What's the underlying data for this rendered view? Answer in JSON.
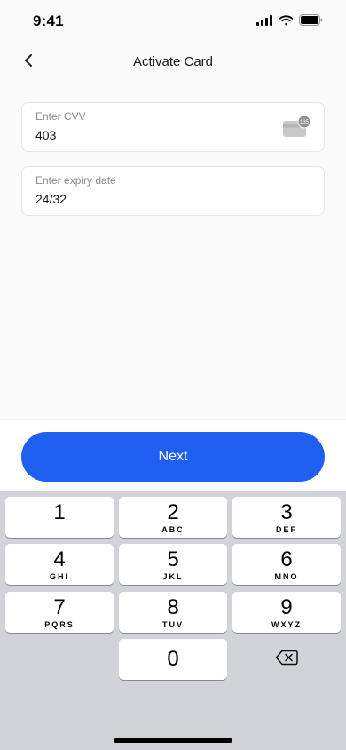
{
  "status_bar": {
    "time": "9:41"
  },
  "nav": {
    "title": "Activate Card"
  },
  "form": {
    "cvv": {
      "label": "Enter CVV",
      "value": "403",
      "card_badge": "135"
    },
    "expiry": {
      "label": "Enter expiry date",
      "value": "24/32"
    }
  },
  "actions": {
    "next_label": "Next",
    "accent_color": "#1f5ff2"
  },
  "keypad": {
    "keys": [
      {
        "digit": "1",
        "letters": ""
      },
      {
        "digit": "2",
        "letters": "ABC"
      },
      {
        "digit": "3",
        "letters": "DEF"
      },
      {
        "digit": "4",
        "letters": "GHI"
      },
      {
        "digit": "5",
        "letters": "JKL"
      },
      {
        "digit": "6",
        "letters": "MNO"
      },
      {
        "digit": "7",
        "letters": "PQRS"
      },
      {
        "digit": "8",
        "letters": "TUV"
      },
      {
        "digit": "9",
        "letters": "WXYZ"
      },
      {
        "digit": "0",
        "letters": ""
      }
    ],
    "delete_icon": "backspace-icon"
  }
}
